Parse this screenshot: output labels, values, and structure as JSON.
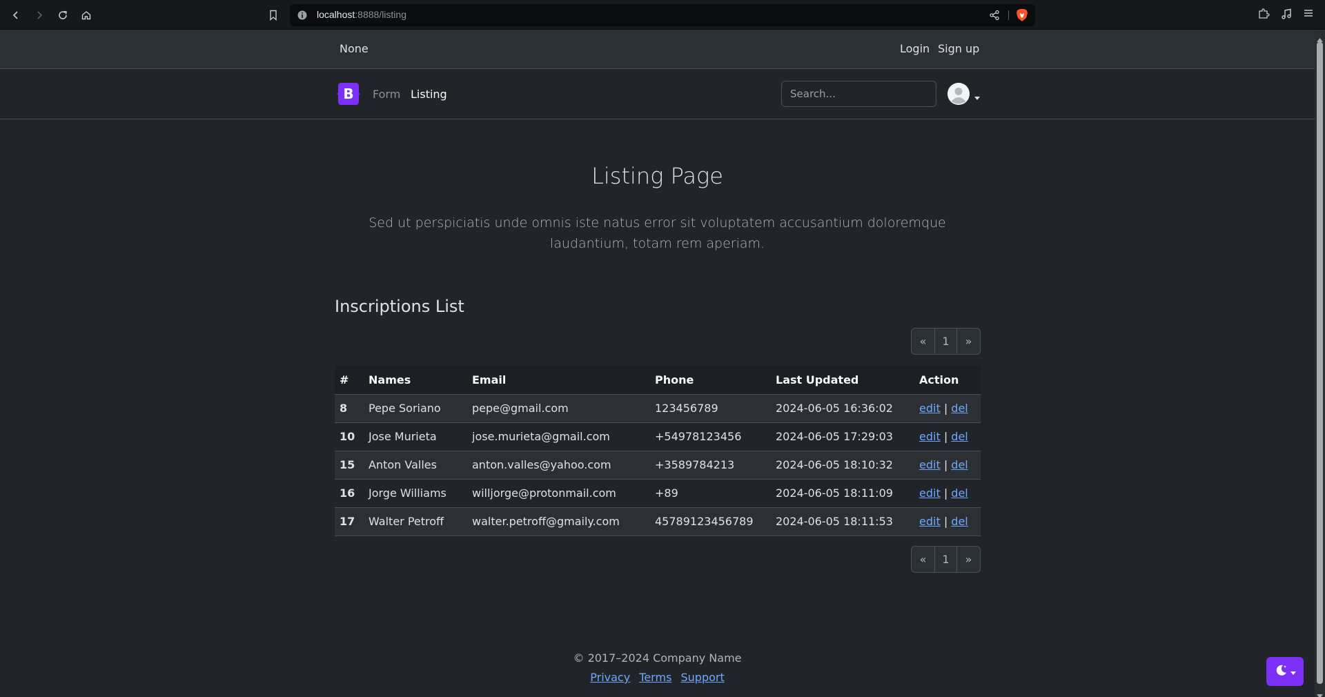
{
  "browser": {
    "url_host": "localhost",
    "url_path": ":8888/listing"
  },
  "topbar": {
    "brand": "None",
    "login": "Login",
    "signup": "Sign up"
  },
  "navbar": {
    "logo_letter": "B",
    "links": [
      "Form",
      "Listing"
    ],
    "search_placeholder": "Search..."
  },
  "main": {
    "title": "Listing Page",
    "lead": "Sed ut perspiciatis unde omnis iste natus error sit voluptatem accusantium doloremque laudantium, totam rem aperiam.",
    "section_title": "Inscriptions List"
  },
  "pagination": {
    "prev": "«",
    "page": "1",
    "next": "»"
  },
  "table": {
    "headers": [
      "#",
      "Names",
      "Email",
      "Phone",
      "Last Updated",
      "Action"
    ],
    "rows": [
      {
        "id": "8",
        "name": "Pepe Soriano",
        "email": "pepe@gmail.com",
        "phone": "123456789",
        "updated": "2024-06-05 16:36:02"
      },
      {
        "id": "10",
        "name": "Jose Murieta",
        "email": "jose.murieta@gmail.com",
        "phone": "+54978123456",
        "updated": "2024-06-05 17:29:03"
      },
      {
        "id": "15",
        "name": "Anton Valles",
        "email": "anton.valles@yahoo.com",
        "phone": "+3589784213",
        "updated": "2024-06-05 18:10:32"
      },
      {
        "id": "16",
        "name": "Jorge Williams",
        "email": "willjorge@protonmail.com",
        "phone": "+89",
        "updated": "2024-06-05 18:11:09"
      },
      {
        "id": "17",
        "name": "Walter Petroff",
        "email": "walter.petroff@gmaily.com",
        "phone": "45789123456789",
        "updated": "2024-06-05 18:11:53"
      }
    ],
    "action_edit": "edit",
    "action_sep": "|",
    "action_del": "del"
  },
  "footer": {
    "copyright": "© 2017–2024 Company Name",
    "links": [
      "Privacy",
      "Terms",
      "Support"
    ]
  },
  "colors": {
    "accent": "#7b2ff7",
    "link": "#6ea8fe",
    "background": "#212529"
  }
}
